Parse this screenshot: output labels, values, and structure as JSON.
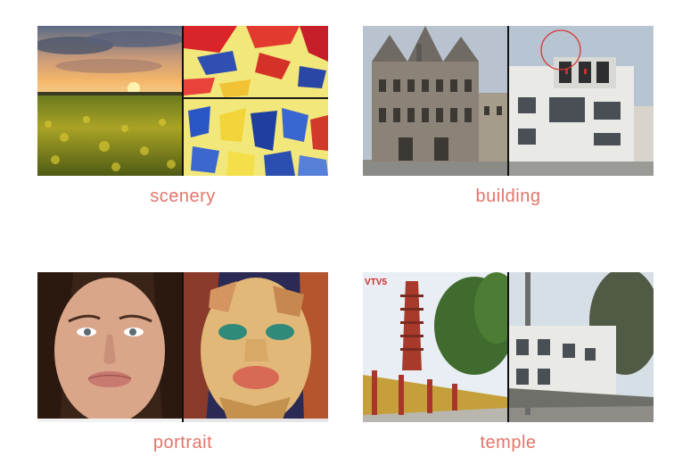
{
  "panels": [
    {
      "caption": "scenery"
    },
    {
      "caption": "building"
    },
    {
      "caption": "portrait"
    },
    {
      "caption": "temple"
    }
  ],
  "temple_logo_text": "VTV5",
  "colors": {
    "caption": "#e2746a",
    "divider": "#111111"
  }
}
